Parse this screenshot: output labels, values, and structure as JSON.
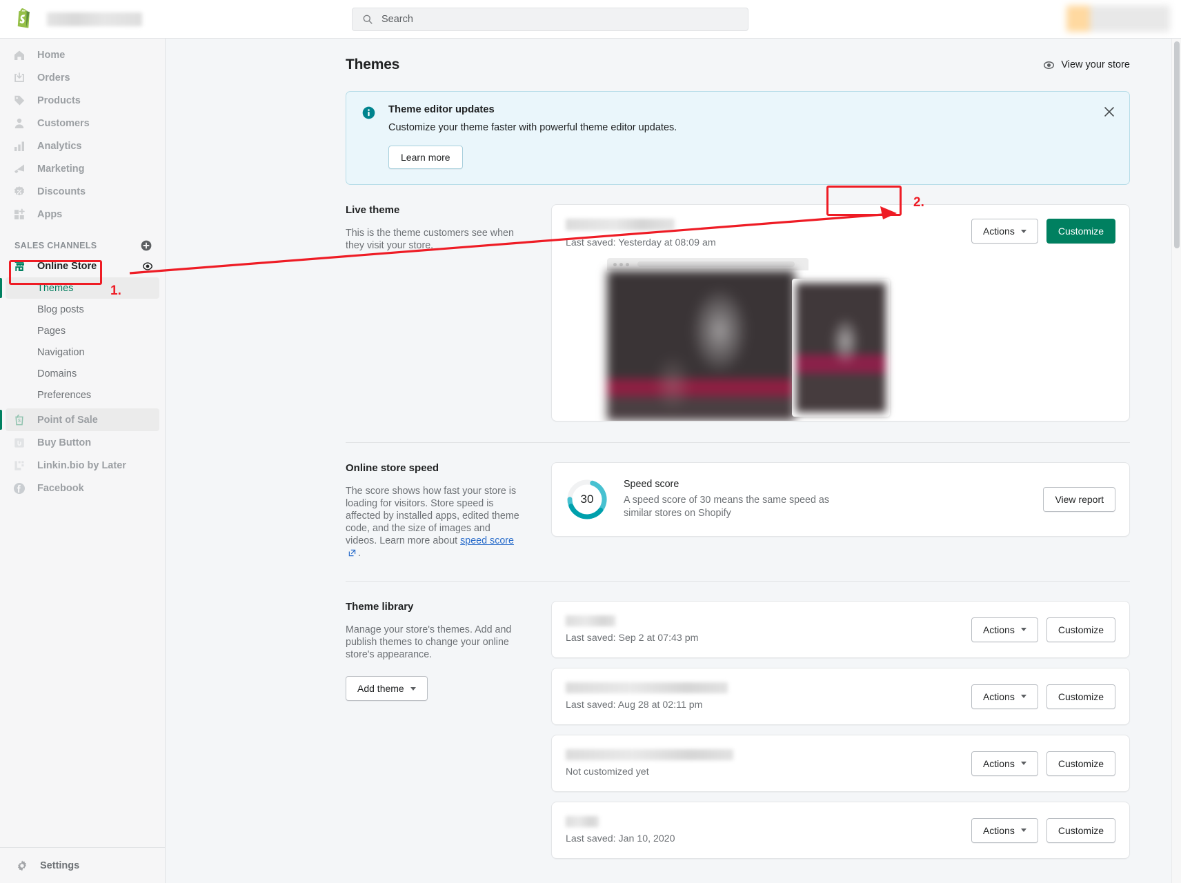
{
  "topbar": {
    "logo_icon": "shopify-bag-icon",
    "store_name_redacted": true,
    "search": {
      "icon": "search-icon",
      "placeholder": "Search",
      "value": ""
    },
    "account_redacted": true
  },
  "sidebar": {
    "primary_items": [
      {
        "label": "Home",
        "icon": "home-icon"
      },
      {
        "label": "Orders",
        "icon": "orders-inbox-icon"
      },
      {
        "label": "Products",
        "icon": "tag-icon"
      },
      {
        "label": "Customers",
        "icon": "person-icon"
      },
      {
        "label": "Analytics",
        "icon": "bar-chart-icon"
      },
      {
        "label": "Marketing",
        "icon": "megaphone-icon"
      },
      {
        "label": "Discounts",
        "icon": "discount-badge-icon"
      },
      {
        "label": "Apps",
        "icon": "apps-grid-plus-icon"
      }
    ],
    "sales_channels_heading": "SALES CHANNELS",
    "add_channel_icon": "plus-circle-icon",
    "online_store": {
      "label": "Online Store",
      "icon": "storefront-icon",
      "view_icon": "eye-icon",
      "sub_items": [
        {
          "label": "Themes",
          "selected": true
        },
        {
          "label": "Blog posts",
          "selected": false
        },
        {
          "label": "Pages",
          "selected": false
        },
        {
          "label": "Navigation",
          "selected": false
        },
        {
          "label": "Domains",
          "selected": false
        },
        {
          "label": "Preferences",
          "selected": false
        }
      ]
    },
    "other_channels": [
      {
        "label": "Point of Sale",
        "icon": "pos-bag-icon",
        "active": true
      },
      {
        "label": "Buy Button",
        "icon": "buy-button-icon",
        "active": false
      },
      {
        "label": "Linkin.bio by Later",
        "icon": "linkinbio-icon",
        "active": false
      },
      {
        "label": "Facebook",
        "icon": "facebook-icon",
        "active": false
      }
    ],
    "settings": {
      "label": "Settings",
      "icon": "gear-icon"
    }
  },
  "page": {
    "title": "Themes",
    "view_store_label": "View your store",
    "view_store_icon": "eye-icon"
  },
  "banner": {
    "icon": "info-circle-icon",
    "title": "Theme editor updates",
    "body": "Customize your theme faster with powerful theme editor updates.",
    "button_label": "Learn more",
    "close_icon": "close-icon"
  },
  "live_theme": {
    "title": "Live theme",
    "description": "This is the theme customers see when they visit your store.",
    "theme_name_redacted": true,
    "last_saved": "Last saved: Yesterday at 08:09 am",
    "actions_label": "Actions",
    "customize_label": "Customize"
  },
  "store_speed": {
    "title": "Online store speed",
    "description_part1": "The score shows how fast your store is loading for visitors. Store speed is affected by installed apps, edited theme code, and the size of images and videos. Learn more about",
    "link_label": "speed score",
    "link_icon": "external-link-icon",
    "description_part2": ".",
    "score": "30",
    "score_max": 100,
    "gauge_color": "#00a0ac",
    "card_title": "Speed score",
    "card_description": "A speed score of 30 means the same speed as similar stores on Shopify",
    "view_report_label": "View report"
  },
  "theme_library": {
    "title": "Theme library",
    "description": "Manage your store's themes. Add and publish themes to change your online store's appearance.",
    "add_theme_label": "Add theme",
    "actions_label": "Actions",
    "customize_label": "Customize",
    "rows": [
      {
        "name_redacted": true,
        "name_width": 72,
        "status": "Last saved: Sep 2 at 07:43 pm"
      },
      {
        "name_redacted": true,
        "name_width": 235,
        "status": "Last saved: Aug 28 at 02:11 pm"
      },
      {
        "name_redacted": true,
        "name_width": 243,
        "status": "Not customized yet"
      },
      {
        "name_redacted": true,
        "name_width": 48,
        "status": "Last saved: Jan 10, 2020"
      }
    ]
  },
  "annotations": {
    "color": "#ee1c25",
    "step1_label": "1.",
    "step2_label": "2.",
    "step1_target": "sidebar-item-themes",
    "step2_target": "live-theme-customize-button"
  },
  "colors": {
    "brand_green": "#008060",
    "banner_bg": "#eaf6fb",
    "banner_border": "#b7dde8",
    "page_bg": "#f4f6f8",
    "sidebar_bg": "#f6f6f7",
    "link_blue": "#2c6ecb",
    "annotation_red": "#ee1c25"
  }
}
